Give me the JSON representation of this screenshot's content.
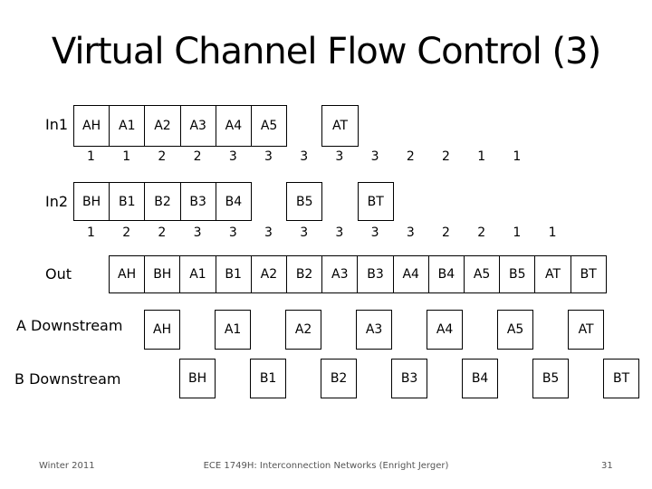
{
  "title": "Virtual Channel Flow Control (3)",
  "rows": {
    "in1": {
      "label": "In1",
      "flits": [
        "AH",
        "A1",
        "A2",
        "A3",
        "A4",
        "A5",
        "",
        "AT"
      ],
      "credits": [
        "1",
        "1",
        "2",
        "2",
        "3",
        "3",
        "3",
        "3",
        "3",
        "2",
        "2",
        "1",
        "1"
      ]
    },
    "in2": {
      "label": "In2",
      "flits": [
        "BH",
        "B1",
        "B2",
        "B3",
        "B4",
        "",
        "B5",
        "",
        "BT"
      ],
      "credits": [
        "1",
        "2",
        "2",
        "3",
        "3",
        "3",
        "3",
        "3",
        "3",
        "3",
        "2",
        "2",
        "1",
        "1"
      ]
    },
    "out": {
      "label": "Out",
      "flits": [
        "AH",
        "BH",
        "A1",
        "B1",
        "A2",
        "B2",
        "A3",
        "B3",
        "A4",
        "B4",
        "A5",
        "B5",
        "AT",
        "BT"
      ]
    },
    "a_downstream": {
      "label": "A Downstream",
      "flits": [
        "AH",
        "A1",
        "A2",
        "A3",
        "A4",
        "A5",
        "AT"
      ]
    },
    "b_downstream": {
      "label": "B Downstream",
      "flits": [
        "BH",
        "B1",
        "B2",
        "B3",
        "B4",
        "B5",
        "BT"
      ]
    }
  },
  "footer": {
    "left": "Winter 2011",
    "center": "ECE 1749H: Interconnection Networks (Enright Jerger)",
    "page_number": "31"
  }
}
